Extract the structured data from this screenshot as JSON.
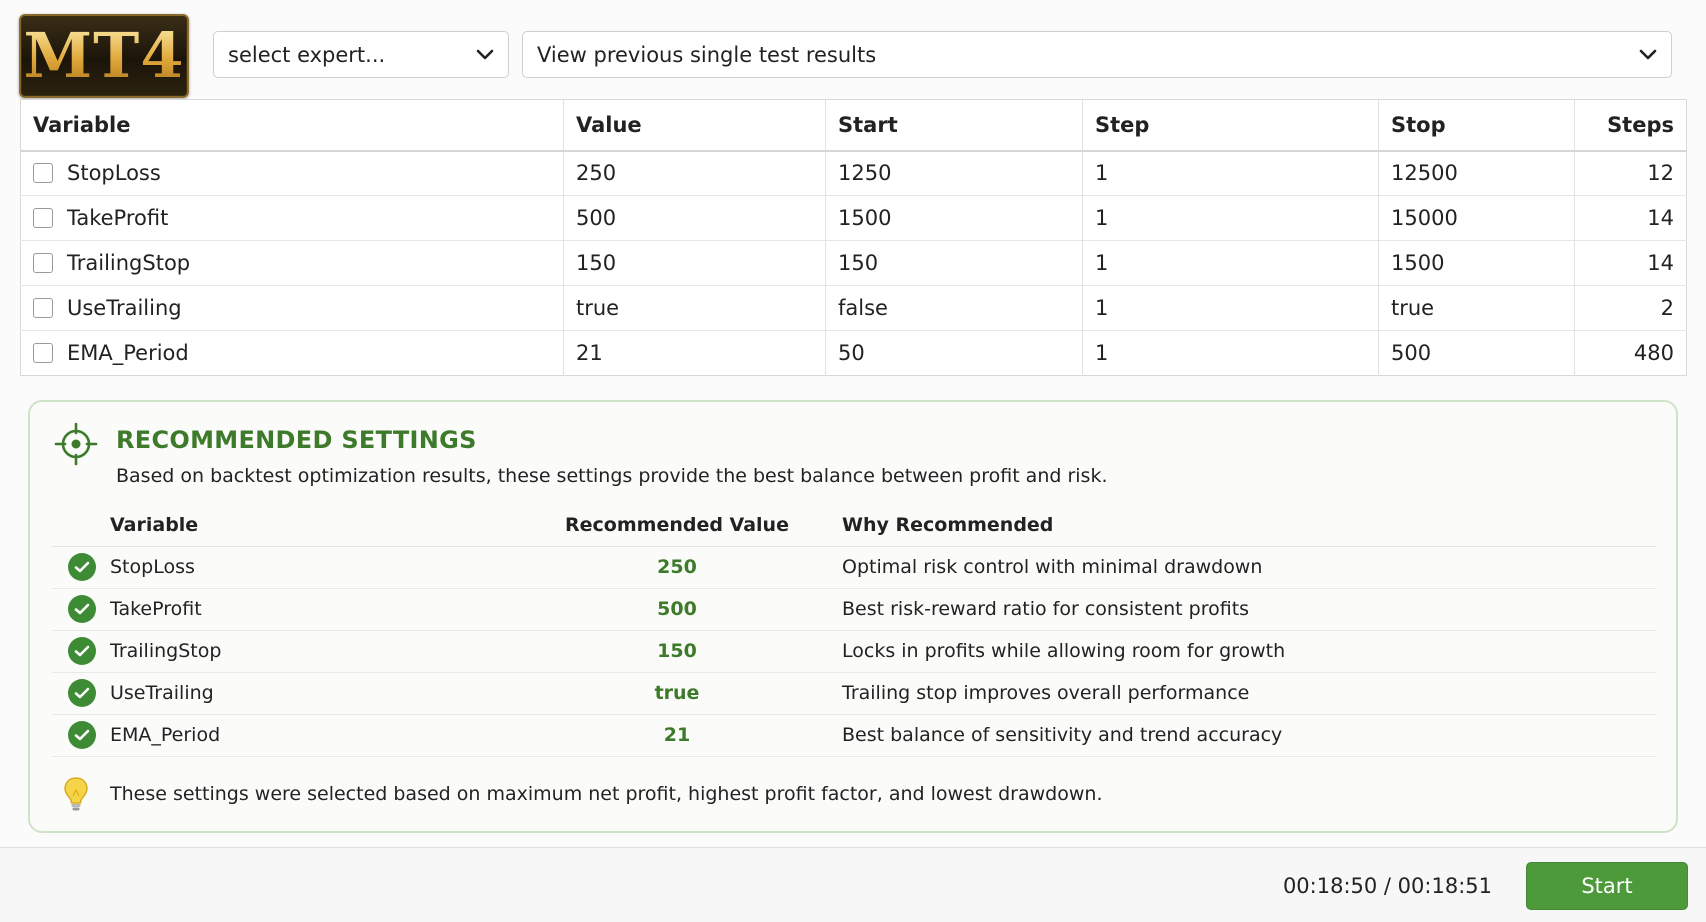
{
  "app": {
    "logo_text": "MT4"
  },
  "toolbar": {
    "expert_select": {
      "value": "select expert..."
    },
    "results_select": {
      "value": "View previous single test results"
    }
  },
  "variables_table": {
    "headers": [
      "Variable",
      "Value",
      "Start",
      "Step",
      "Stop",
      "Steps"
    ],
    "rows": [
      {
        "checked": false,
        "variable": "StopLoss",
        "value": "250",
        "start": "1250",
        "step": "1",
        "stop": "12500",
        "steps": "12"
      },
      {
        "checked": false,
        "variable": "TakeProfit",
        "value": "500",
        "start": "1500",
        "step": "1",
        "stop": "15000",
        "steps": "14"
      },
      {
        "checked": false,
        "variable": "TrailingStop",
        "value": "150",
        "start": "150",
        "step": "1",
        "stop": "1500",
        "steps": "14"
      },
      {
        "checked": false,
        "variable": "UseTrailing",
        "value": "true",
        "start": "false",
        "step": "1",
        "stop": "true",
        "steps": "2"
      },
      {
        "checked": false,
        "variable": "EMA_Period",
        "value": "21",
        "start": "50",
        "step": "1",
        "stop": "500",
        "steps": "480"
      }
    ]
  },
  "recommended": {
    "title": "RECOMMENDED SETTINGS",
    "description": "Based on backtest optimization results, these settings provide the best balance between profit and risk.",
    "headers": {
      "variable": "Variable",
      "value": "Recommended Value",
      "why": "Why Recommended"
    },
    "rows": [
      {
        "variable": "StopLoss",
        "value": "250",
        "why": "Optimal risk control with minimal drawdown"
      },
      {
        "variable": "TakeProfit",
        "value": "500",
        "why": "Best risk-reward ratio for consistent profits"
      },
      {
        "variable": "TrailingStop",
        "value": "150",
        "why": "Locks in profits while allowing room for growth"
      },
      {
        "variable": "UseTrailing",
        "value": "true",
        "why": "Trailing stop improves overall performance"
      },
      {
        "variable": "EMA_Period",
        "value": "21",
        "why": "Best balance of sensitivity and trend accuracy"
      }
    ],
    "note": "These settings were selected based on maximum net profit, highest profit factor, and lowest drawdown.",
    "accent_color": "#3d7a2a"
  },
  "footer": {
    "time_display": "00:18:50 / 00:18:51",
    "start_label": "Start",
    "button_color": "#4c9a3a"
  },
  "icons": {
    "logo": "mt4-logo",
    "dropdown": "chevron-down-icon",
    "section": "target-icon",
    "row_status": "check-circle-icon",
    "note": "lightbulb-icon"
  }
}
